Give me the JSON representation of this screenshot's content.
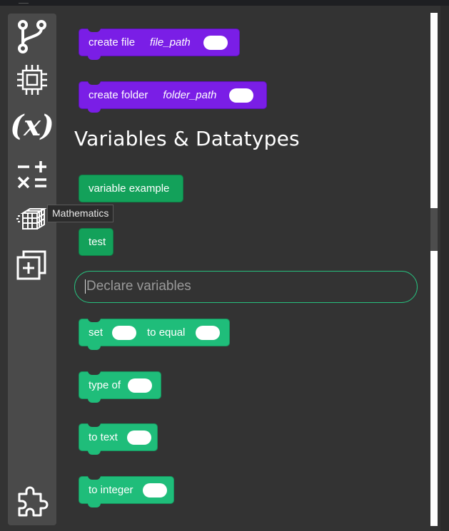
{
  "sidebar": {
    "items": [
      {
        "icon": "branch-icon"
      },
      {
        "icon": "cpu-chip-icon"
      },
      {
        "icon": "variables-x-icon"
      },
      {
        "icon": "math-operators-icon"
      },
      {
        "icon": "cube-grid-icon"
      },
      {
        "icon": "add-layers-icon"
      },
      {
        "icon": "puzzle-piece-icon"
      }
    ]
  },
  "tooltip": {
    "text": "Mathematics"
  },
  "blocks": {
    "create_file": {
      "label": "create file",
      "param": "file_path"
    },
    "create_folder": {
      "label": "create folder",
      "param": "folder_path"
    },
    "variable_example": {
      "label": "variable example"
    },
    "test": {
      "label": "test"
    },
    "set": {
      "label": "set",
      "mid": "to equal"
    },
    "type_of": {
      "label": "type of"
    },
    "to_text": {
      "label": "to text"
    },
    "to_integer": {
      "label": "to integer"
    }
  },
  "section": {
    "title": "Variables & Datatypes"
  },
  "search": {
    "placeholder": "Declare variables"
  },
  "colors": {
    "file_blocks": "#7a1ee6",
    "variable_blocks": "#1fbd7a",
    "custom_blocks": "#13a15a",
    "search_border": "#27c07e",
    "background": "#333333"
  }
}
